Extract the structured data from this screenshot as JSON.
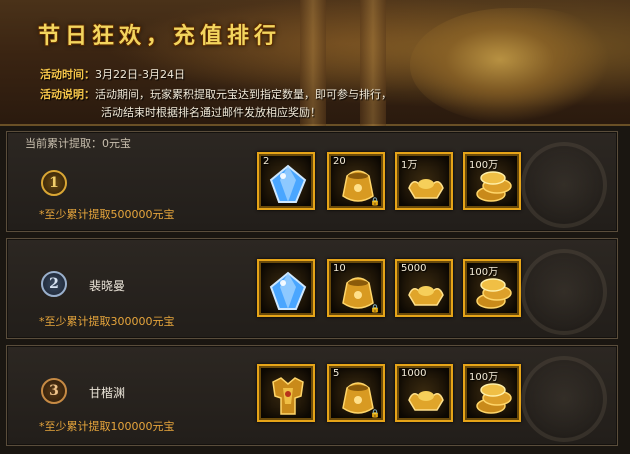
{
  "banner": {
    "title": "节日狂欢，充值排行",
    "time_label": "活动时间：",
    "time_value": "3月22日-3月24日",
    "desc_label": "活动说明：",
    "desc_line1": "活动期间，玩家累积提取元宝达到指定数量，即可参与排行，",
    "desc_line2": "活动结束时根据排名通过邮件发放相应奖励！"
  },
  "current": "当前累计提取：0元宝",
  "ranks": [
    {
      "rank": "1",
      "name": "",
      "requirement": "*至少累计提取500000元宝",
      "rewards": [
        {
          "icon": "blue-gem-icon",
          "count": "2"
        },
        {
          "icon": "gold-pouch-icon",
          "count": "20"
        },
        {
          "icon": "gold-ingot-icon",
          "count": "1万"
        },
        {
          "icon": "gold-coins-icon",
          "count": "100万"
        }
      ]
    },
    {
      "rank": "2",
      "name": "裴晓曼",
      "requirement": "*至少累计提取300000元宝",
      "rewards": [
        {
          "icon": "blue-gem-icon",
          "count": ""
        },
        {
          "icon": "gold-pouch-icon",
          "count": "10"
        },
        {
          "icon": "gold-ingot-icon",
          "count": "5000"
        },
        {
          "icon": "gold-coins-icon",
          "count": "100万"
        }
      ]
    },
    {
      "rank": "3",
      "name": "甘楷渊",
      "requirement": "*至少累计提取100000元宝",
      "rewards": [
        {
          "icon": "gold-armor-icon",
          "count": ""
        },
        {
          "icon": "gold-pouch-icon",
          "count": "5"
        },
        {
          "icon": "gold-ingot-icon",
          "count": "1000"
        },
        {
          "icon": "gold-coins-icon",
          "count": "100万"
        }
      ]
    }
  ],
  "colors": {
    "gold": "#e6a418",
    "title": "#f3d55e",
    "requirement": "#e6a53c"
  }
}
